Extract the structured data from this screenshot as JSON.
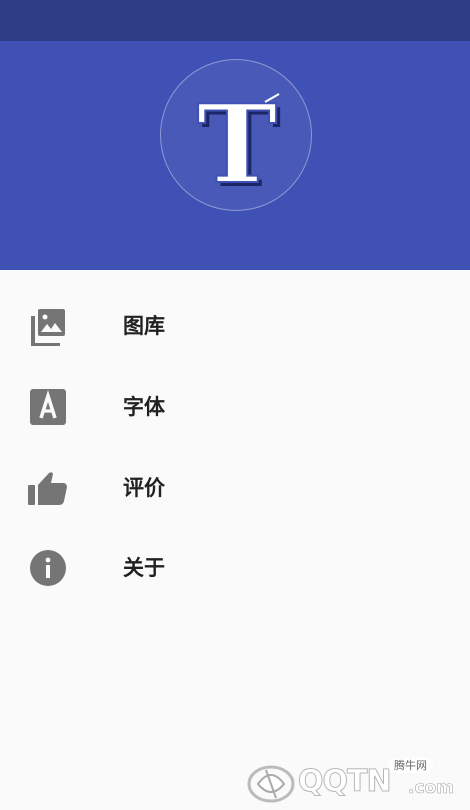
{
  "header": {
    "logo_letter": "T"
  },
  "menu": {
    "items": [
      {
        "label": "图库",
        "icon": "photo-library-icon"
      },
      {
        "label": "字体",
        "icon": "font-a-icon"
      },
      {
        "label": "评价",
        "icon": "thumb-up-icon"
      },
      {
        "label": "关于",
        "icon": "info-icon"
      }
    ]
  },
  "watermark": {
    "cn_text": "腾牛网",
    "brand": "QQTN",
    "domain": ".com"
  },
  "colors": {
    "status_bar": "#2f3d86",
    "header": "#3f51b5",
    "icon": "#757575",
    "text": "#212121",
    "background": "#fafafa"
  }
}
